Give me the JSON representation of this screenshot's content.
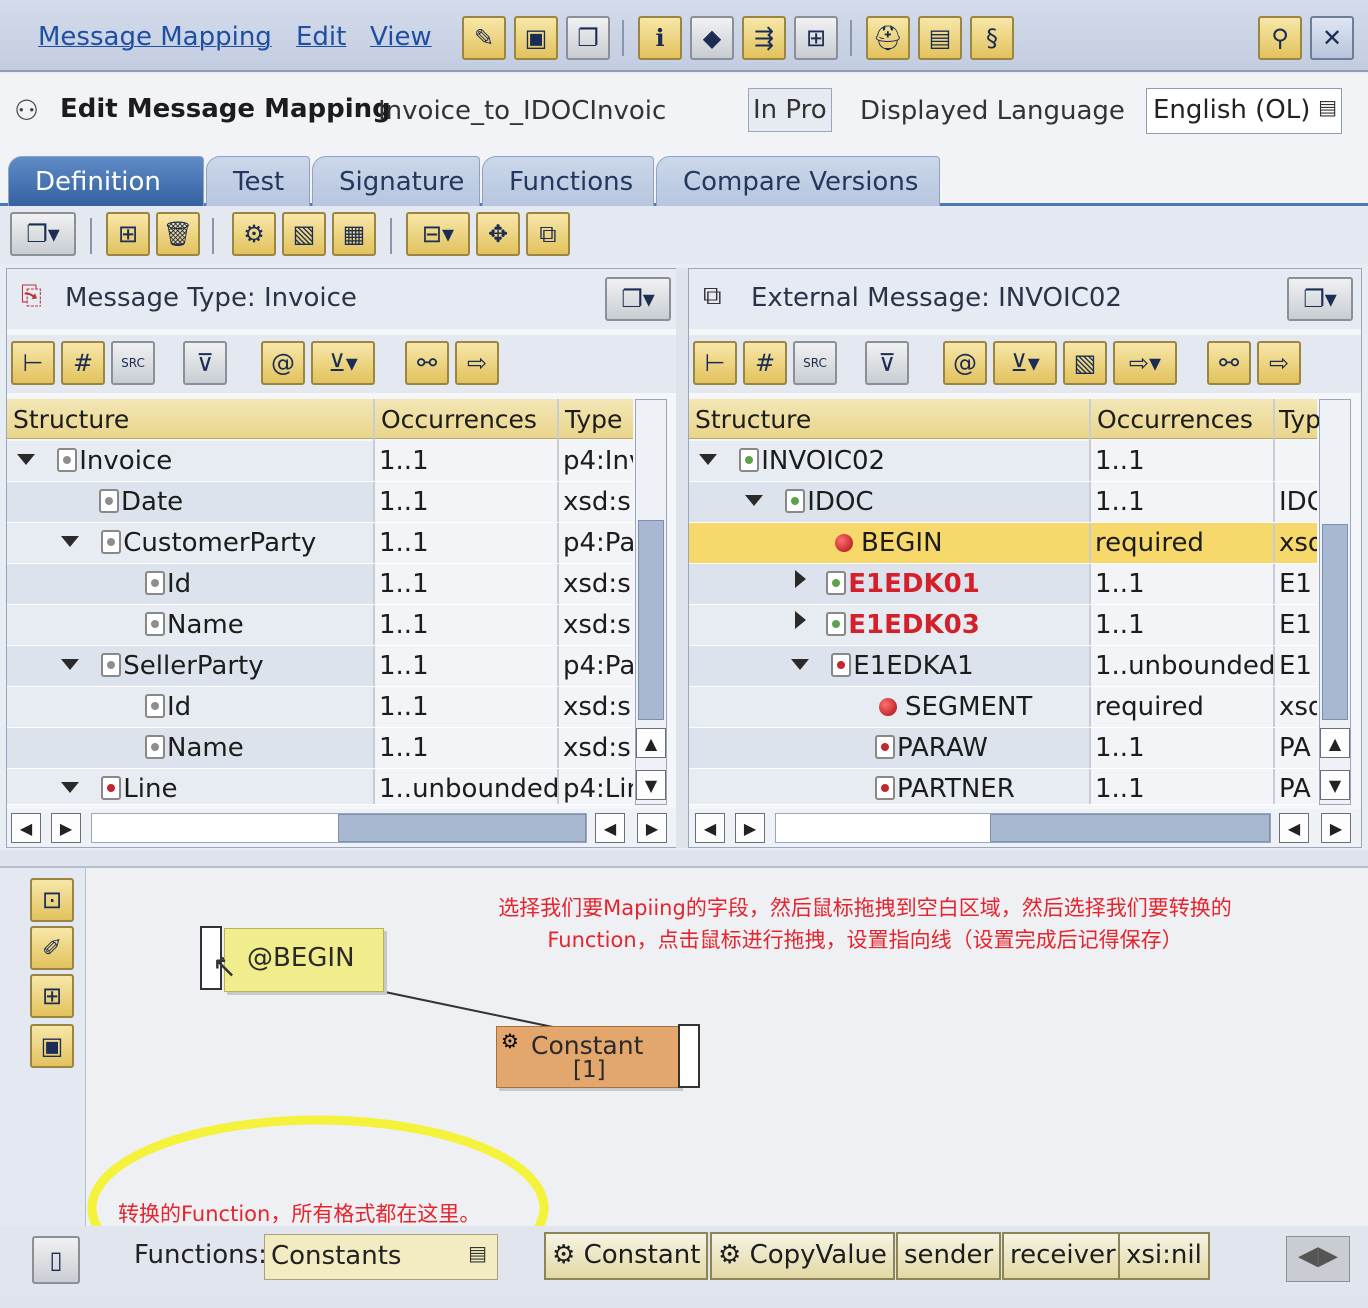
{
  "menubar": {
    "items": [
      "Message Mapping",
      "Edit",
      "View"
    ]
  },
  "header": {
    "title": "Edit Message Mapping",
    "object_name": "Invoice_to_IDOCInvoic",
    "status": "In Pro",
    "language_label": "Displayed Language",
    "language_value": "English (OL)"
  },
  "tabs": [
    "Definition",
    "Test",
    "Signature",
    "Functions",
    "Compare Versions"
  ],
  "left_pane": {
    "title": "Message Type: Invoice",
    "columns": [
      "Structure",
      "Occurrences",
      "Type"
    ],
    "rows": [
      {
        "name": "Invoice",
        "occ": "1..1",
        "type": "p4:Inv"
      },
      {
        "name": "Date",
        "occ": "1..1",
        "type": "xsd:s"
      },
      {
        "name": "CustomerParty",
        "occ": "1..1",
        "type": "p4:Pa"
      },
      {
        "name": "Id",
        "occ": "1..1",
        "type": "xsd:s"
      },
      {
        "name": "Name",
        "occ": "1..1",
        "type": "xsd:s"
      },
      {
        "name": "SellerParty",
        "occ": "1..1",
        "type": "p4:Pa"
      },
      {
        "name": "Id",
        "occ": "1..1",
        "type": "xsd:s"
      },
      {
        "name": "Name",
        "occ": "1..1",
        "type": "xsd:s"
      },
      {
        "name": "Line",
        "occ": "1..unbounded",
        "type": "p4:Lin"
      }
    ]
  },
  "right_pane": {
    "title": "External Message: INVOIC02",
    "columns": [
      "Structure",
      "Occurrences",
      "Typ"
    ],
    "rows": [
      {
        "name": "INVOIC02",
        "occ": "1..1",
        "type": ""
      },
      {
        "name": "IDOC",
        "occ": "1..1",
        "type": "IDO"
      },
      {
        "name": "BEGIN",
        "occ": "required",
        "type": "xsd"
      },
      {
        "name": "E1EDK01",
        "occ": "1..1",
        "type": "E1"
      },
      {
        "name": "E1EDK03",
        "occ": "1..1",
        "type": "E1"
      },
      {
        "name": "E1EDKA1",
        "occ": "1..unbounded",
        "type": "E1"
      },
      {
        "name": "SEGMENT",
        "occ": "required",
        "type": "xsd"
      },
      {
        "name": "PARAW",
        "occ": "1..1",
        "type": "PA"
      },
      {
        "name": "PARTNER",
        "occ": "1..1",
        "type": "PA"
      }
    ]
  },
  "editor": {
    "target_node": "@BEGIN",
    "function_node": "Constant",
    "function_value": "[1]",
    "annotation_top": "选择我们要Mapiing的字段，然后鼠标拖拽到空白区域，然后选择我们要转换的Function，点击鼠标进行拖拽，设置指向线（设置完成后记得保存）",
    "annotation_top_line1": "选择我们要Mapiing的字段，然后鼠标拖拽到空白区域，然后选择我们要转换的",
    "annotation_top_line2": "Function，点击鼠标进行拖拽，设置指向线（设置完成后记得保存）",
    "annotation_bottom": "转换的Function，所有格式都在这里。"
  },
  "functions_bar": {
    "label": "Functions:",
    "selected": "Constants",
    "buttons": [
      "Constant",
      "CopyValue",
      "sender",
      "receiver",
      "xsi:nil"
    ]
  }
}
